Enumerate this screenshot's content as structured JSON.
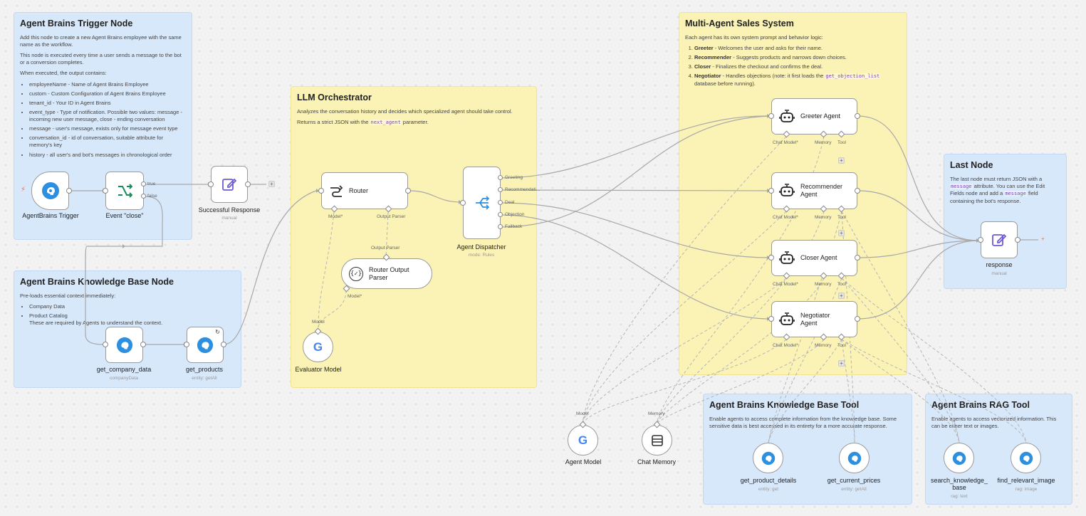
{
  "notes": {
    "trigger": {
      "title": "Agent Brains Trigger Node",
      "p1": "Add this node to create a new Agent Brains employee with the same name as the workflow.",
      "p2": "This node is executed every time a user sends a message to the bot or a conversion completes.",
      "p3": "When executed, the output contains:",
      "items": [
        "employeeName - Name of Agent Brains Employee",
        "custom - Custom Configuration of Agent Brains Employee",
        "tenant_id - Your ID in Agent Brains",
        "event_type - Type of notification. Possible two values: message - incoming new user message, close - ending conversation",
        "message - user's message, exists only for message event type",
        "conversation_id - id of conversation, suitable attribute for memory's key",
        "history - all user's and bot's messages in chronological order"
      ]
    },
    "kb_node": {
      "title": "Agent Brains Knowledge Base Node",
      "p1": "Pre-loads essential context immediately:",
      "items": [
        "Company Data",
        "Product Catalog"
      ],
      "p2": "These are required by Agents to understand the context."
    },
    "orchestrator": {
      "title": "LLM Orchestrator",
      "p1": "Analyzes the conversation history and decides which specialized agent should take control.",
      "p2_prefix": "Returns a strict JSON with the",
      "p2_code": "next_agent",
      "p2_suffix": "parameter."
    },
    "sales": {
      "title": "Multi-Agent Sales System",
      "p1": "Each agent has its own system prompt and behavior logic:",
      "items": [
        {
          "bold": "Greeter",
          "text": " - Welcomes the user and asks for their name."
        },
        {
          "bold": "Recommender",
          "text": " - Suggests products and narrows down choices."
        },
        {
          "bold": "Closer",
          "text": " - Finalizes the checkout and confirms the deal."
        },
        {
          "bold": "Negotiator",
          "text": " - Handles objections (note: it first loads the ",
          "code": "get_objection_list",
          "text2": " database before running)."
        }
      ]
    },
    "last": {
      "title": "Last Node",
      "p1_a": "The last node must return JSON with a",
      "p1_code": "message",
      "p1_b": "attribute. You can use the Edit Fields node and add a",
      "p1_code2": "message",
      "p1_c": "field containing the bot's response."
    },
    "kb_tool": {
      "title": "Agent Brains Knowledge Base Tool",
      "p1": "Enable agents to access complete information from the knowledge base. Some sensitive data is best accessed in its entirety for a more accurate response."
    },
    "rag_tool": {
      "title": "Agent Brains RAG Tool",
      "p1": "Enable agents to access vectorized information. This can be either text or images."
    }
  },
  "nodes": {
    "trigger": {
      "label": "AgentBrains Trigger"
    },
    "event_close": {
      "label": "Event \"close\"",
      "out_true": "true",
      "out_false": "false"
    },
    "success": {
      "label": "Successful Response",
      "sub": "manual"
    },
    "company": {
      "label": "get_company_data",
      "sub": "companyData"
    },
    "products": {
      "label": "get_products",
      "sub": "entity: getAll"
    },
    "router": {
      "label": "Router",
      "port_model": "Model*",
      "port_parser": "Output Parser"
    },
    "parser": {
      "label": "Router Output Parser",
      "in_label": "Output Parser",
      "port_model": "Model*"
    },
    "evaluator": {
      "label": "Evaluator Model",
      "in_label": "Model"
    },
    "dispatcher": {
      "label": "Agent Dispatcher",
      "sub": "mode: Rules",
      "outputs": [
        "Greeting",
        "Recommendati...",
        "Deal",
        "Objection",
        "Fallback"
      ]
    },
    "agents": [
      {
        "label": "Greeter Agent"
      },
      {
        "label": "Recommender Agent"
      },
      {
        "label": "Closer Agent"
      },
      {
        "label": "Negotiator Agent"
      }
    ],
    "agent_ports": {
      "model": "Chat Model*",
      "memory": "Memory",
      "tool": "Tool"
    },
    "agent_model": {
      "label": "Agent Model",
      "in_label": "Model"
    },
    "chat_memory": {
      "label": "Chat Memory",
      "in_label": "Memory"
    },
    "response": {
      "label": "response",
      "sub": "manual"
    },
    "product_details": {
      "label": "get_product_details",
      "sub": "entity: get"
    },
    "current_prices": {
      "label": "get_current_prices",
      "sub": "entity: getAll"
    },
    "search_kb": {
      "label": "search_knowledge_ base",
      "sub": "rag: text"
    },
    "relevant_image": {
      "label": "find_relevant_image",
      "sub": "rag: image"
    }
  },
  "colors": {
    "note_blue": "#d8e8fb",
    "note_yellow": "#fbf3b5",
    "brain_blue": "#2d8fe0",
    "filter_green": "#1a8a5a",
    "edit_purple": "#6e5ad4",
    "trigger_orange": "#ff6d3a"
  },
  "icons": {
    "trigger": "brain-icon",
    "event_close": "filter-icon",
    "success": "edit-icon",
    "router": "route-icon",
    "parser": "braces-icon",
    "evaluator": "google-icon",
    "dispatcher": "switch-icon",
    "agent": "robot-icon",
    "memory": "database-icon",
    "response": "edit-icon"
  }
}
